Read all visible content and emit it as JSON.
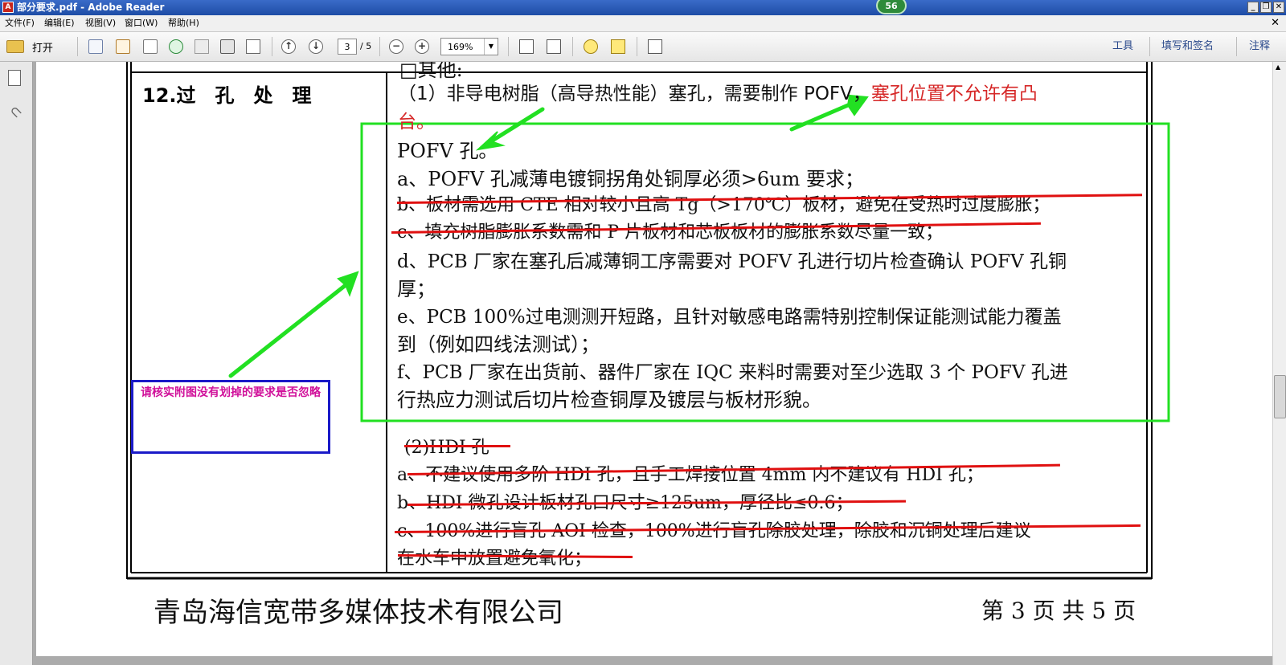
{
  "window": {
    "title": "部分要求.pdf - Adobe Reader",
    "app_icon": "pdf-icon",
    "notification_count": "56"
  },
  "menu": [
    "文件(F)",
    "编辑(E)",
    "视图(V)",
    "窗口(W)",
    "帮助(H)"
  ],
  "toolbar": {
    "open_label": "打开",
    "current_page": "3",
    "page_total": "/ 5",
    "zoom": "169%",
    "right_links": [
      "工具",
      "填写和签名",
      "注释"
    ]
  },
  "document": {
    "top_cut_text": "□其他:",
    "section_header": "12.过　孔　处　理",
    "item1_black": "（1）非导电树脂（高导热性能）塞孔，需要制作 POFV，",
    "item1_red_a": "塞孔位置不允许有凸",
    "item1_red_b": "台。",
    "lines": [
      "POFV 孔。",
      "a、POFV 孔减薄电镀铜拐角处铜厚必须>6um 要求；",
      "b、板材需选用 CTE 相对较小且高 Tg（>170℃）板材，避免在受热时过度膨胀；",
      "c、填充树脂膨胀系数需和 P 片板材和芯板板材的膨胀系数尽量一致；",
      "d、PCB 厂家在塞孔后减薄铜工序需要对 POFV 孔进行切片检查确认 POFV 孔铜",
      "厚；",
      "e、PCB 100%过电测测开短路，且针对敏感电路需特别控制保证能测试能力覆盖",
      "到（例如四线法测试）；",
      "f、PCB 厂家在出货前、器件厂家在 IQC 来料时需要对至少选取 3 个 POFV 孔进",
      "行热应力测试后切片检查铜厚及镀层与板材形貌。"
    ],
    "hdi_lines": [
      "(2)HDI 孔",
      "a、不建议使用多阶 HDI 孔，且手工焊接位置 4mm 内不建议有 HDI 孔；",
      "b、HDI 微孔设计板材孔口尺寸≥125um，厚径比≤0.6；",
      "c、100%进行盲孔 AOI 检查，100%进行盲孔除胶处理，除胶和沉铜处理后建议",
      "在水车中放置避免氧化；"
    ],
    "annotation_note": "请核实附图没有划掉的要求是否忽略",
    "footer_company": "青岛海信宽带多媒体技术有限公司",
    "footer_page": "第 3 页  共 5 页"
  },
  "colors": {
    "annotation_green": "#22e022",
    "annotation_red": "#e01010",
    "note_border": "#1a1ac8",
    "note_text": "#d0109a",
    "highlight_red_text": "#d62828"
  }
}
